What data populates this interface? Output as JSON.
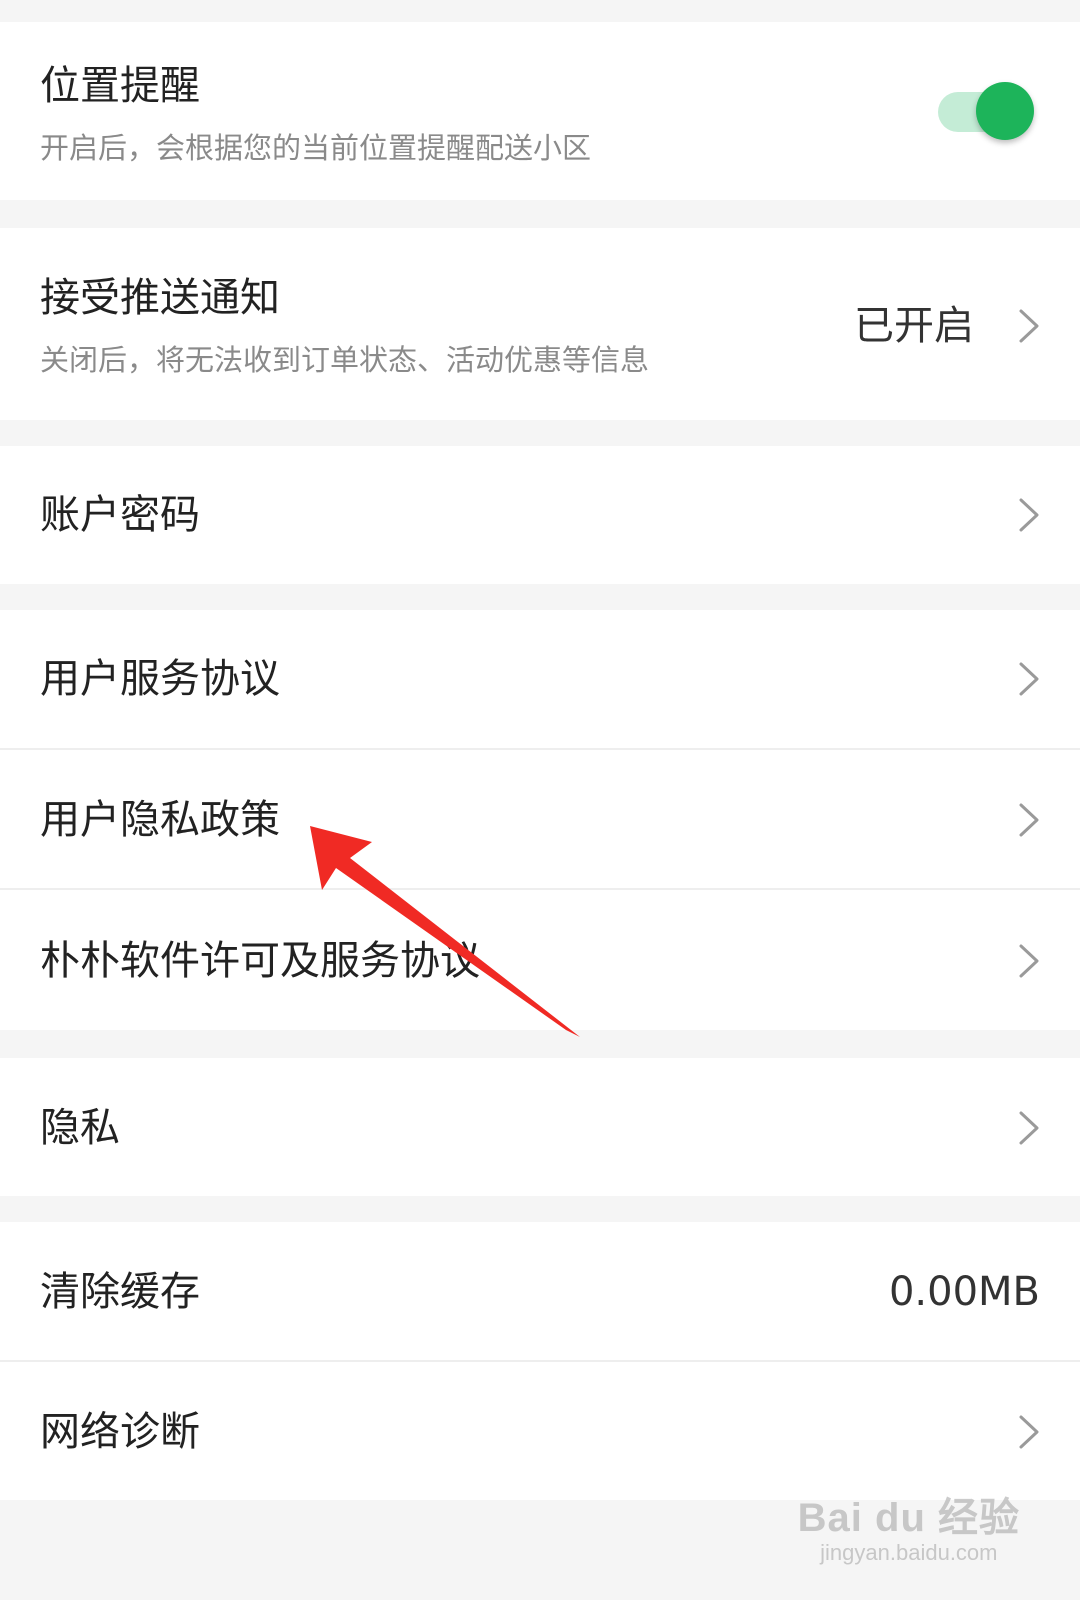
{
  "settings": {
    "location_reminder": {
      "title": "位置提醒",
      "subtitle": "开启后，会根据您的当前位置提醒配送小区",
      "toggle_on": true
    },
    "push_notifications": {
      "title": "接受推送通知",
      "subtitle": "关闭后，将无法收到订单状态、活动优惠等信息",
      "value": "已开启"
    },
    "account_password": {
      "title": "账户密码"
    },
    "user_service_agreement": {
      "title": "用户服务协议"
    },
    "user_privacy_policy": {
      "title": "用户隐私政策"
    },
    "software_license": {
      "title": "朴朴软件许可及服务协议"
    },
    "privacy": {
      "title": "隐私"
    },
    "clear_cache": {
      "title": "清除缓存",
      "value": "0.00MB"
    },
    "network_diagnosis": {
      "title": "网络诊断"
    }
  },
  "colors": {
    "toggle_knob": "#1db45a",
    "toggle_track": "#c4ecd6",
    "annotation_arrow": "#f02a24",
    "page_background": "#f5f5f5"
  },
  "icons": {
    "chevron": "chevron-right-icon"
  },
  "watermark": {
    "logo": "Bai du 经验",
    "url": "jingyan.baidu.com"
  }
}
